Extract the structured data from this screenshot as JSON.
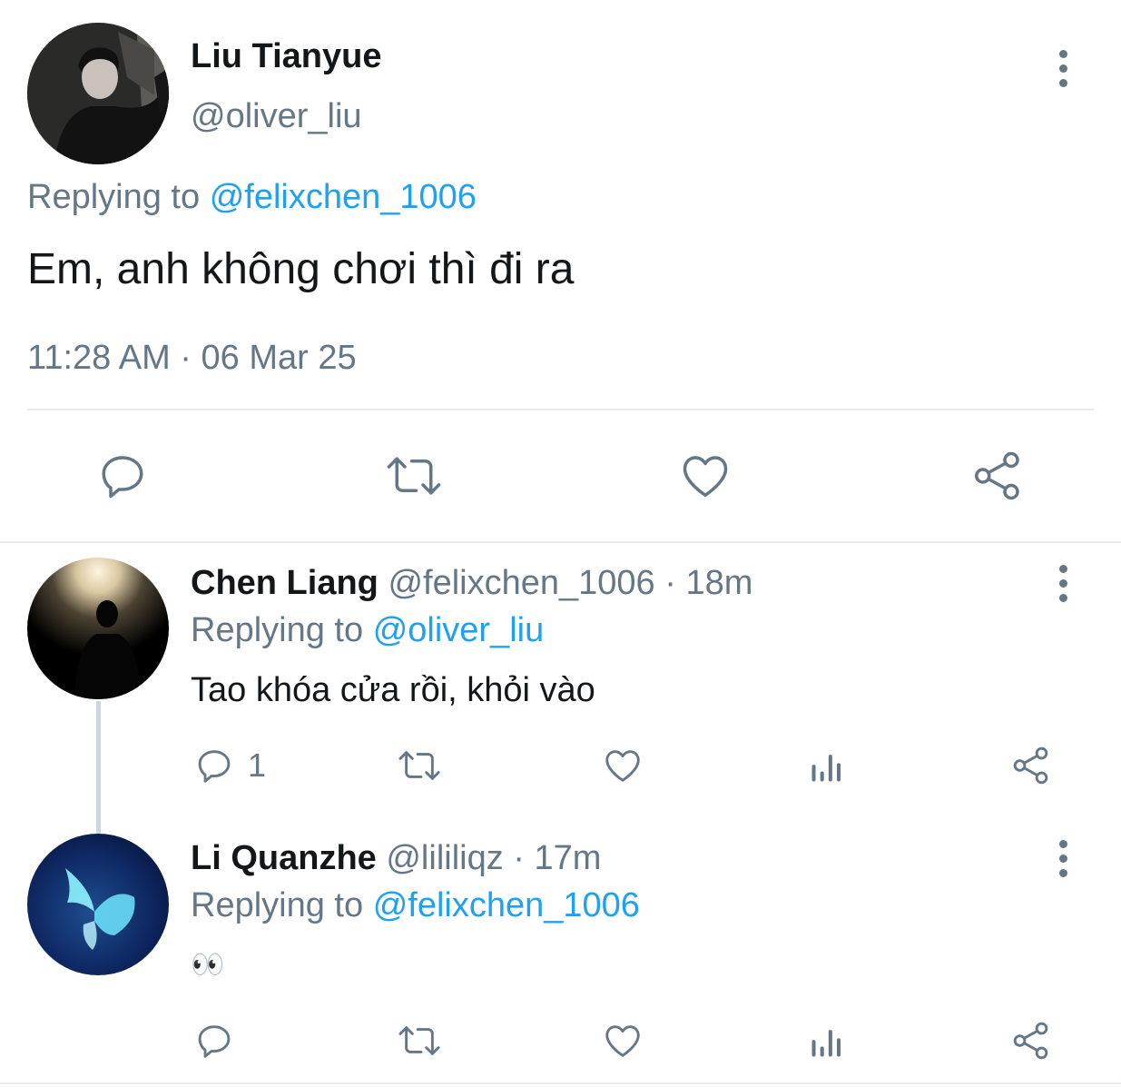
{
  "main_tweet": {
    "author_name": "Liu Tianyue",
    "handle": "@oliver_liu",
    "replying_prefix": "Replying to",
    "replying_handle": "@felixchen_1006",
    "text": "Em, anh không chơi thì đi ra",
    "timestamp": "11:28 AM · 06 Mar 25",
    "actions": [
      "reply-icon",
      "retweet-icon",
      "like-icon",
      "share-icon"
    ]
  },
  "replies": [
    {
      "author_name": "Chen Liang",
      "handle": "@felixchen_1006",
      "separator": "·",
      "time": "18m",
      "replying_prefix": "Replying to",
      "replying_handle": "@oliver_liu",
      "text": "Tao khóa cửa rồi, khỏi vào",
      "reply_count": "1",
      "actions": [
        "reply-icon",
        "retweet-icon",
        "like-icon",
        "analytics-icon",
        "share-icon"
      ]
    },
    {
      "author_name": "Li Quanzhe",
      "handle": "@lililiqz",
      "separator": "·",
      "time": "17m",
      "replying_prefix": "Replying to",
      "replying_handle": "@felixchen_1006",
      "text": "👀",
      "reply_count": "",
      "actions": [
        "reply-icon",
        "retweet-icon",
        "like-icon",
        "analytics-icon",
        "share-icon"
      ]
    }
  ],
  "colors": {
    "accent": "#1da1f2",
    "secondary_text": "#657786",
    "primary_text": "#14171a",
    "divider": "#e6ecf0"
  }
}
